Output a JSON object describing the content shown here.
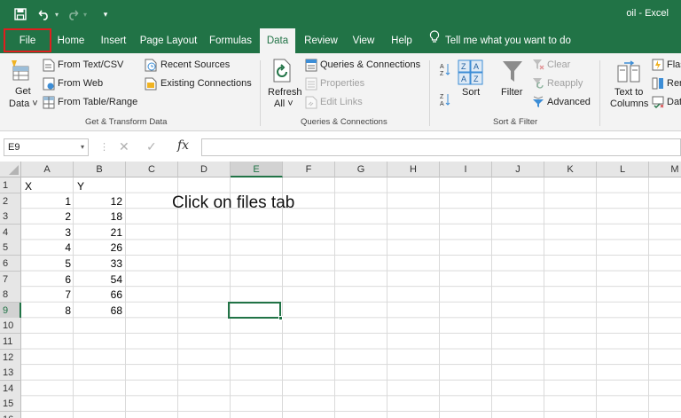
{
  "window": {
    "title": "oil  -  Excel"
  },
  "tabs": {
    "file": "File",
    "home": "Home",
    "insert": "Insert",
    "page_layout": "Page Layout",
    "formulas": "Formulas",
    "data": "Data",
    "review": "Review",
    "view": "View",
    "help": "Help",
    "tell_me": "Tell me what you want to do"
  },
  "ribbon": {
    "get_data_line1": "Get",
    "get_data_line2": "Data ˅",
    "from_text_csv": "From Text/CSV",
    "from_web": "From Web",
    "from_table_range": "From Table/Range",
    "recent_sources": "Recent Sources",
    "existing_connections": "Existing Connections",
    "group_get_transform": "Get & Transform Data",
    "refresh_all_line1": "Refresh",
    "refresh_all_line2": "All ˅",
    "queries_connections": "Queries & Connections",
    "properties": "Properties",
    "edit_links": "Edit Links",
    "group_queries": "Queries & Connections",
    "sort": "Sort",
    "filter": "Filter",
    "clear": "Clear",
    "reapply": "Reapply",
    "advanced": "Advanced",
    "group_sort_filter": "Sort & Filter",
    "text_to_columns_line1": "Text to",
    "text_to_columns_line2": "Columns",
    "flash_fill": "Flas",
    "remove_duplicates": "Rer",
    "data_validation": "Dat"
  },
  "formula_bar": {
    "name_box": "E9",
    "formula": ""
  },
  "sheet": {
    "columns": [
      "A",
      "B",
      "C",
      "D",
      "E",
      "F",
      "G",
      "H",
      "I",
      "J",
      "K",
      "L",
      "M"
    ],
    "rows": [
      "1",
      "2",
      "3",
      "4",
      "5",
      "6",
      "7",
      "8",
      "9",
      "10",
      "11",
      "12",
      "13",
      "14",
      "15",
      "16"
    ],
    "header_x": "X",
    "header_y": "Y",
    "x_values": [
      "1",
      "2",
      "3",
      "4",
      "5",
      "6",
      "7",
      "8"
    ],
    "y_values": [
      "12",
      "18",
      "21",
      "26",
      "33",
      "54",
      "66",
      "68"
    ],
    "selected_cell": "E9",
    "annotation": "Click on files tab"
  },
  "colors": {
    "excel_green": "#217346",
    "highlight_red": "#e01e1e"
  }
}
